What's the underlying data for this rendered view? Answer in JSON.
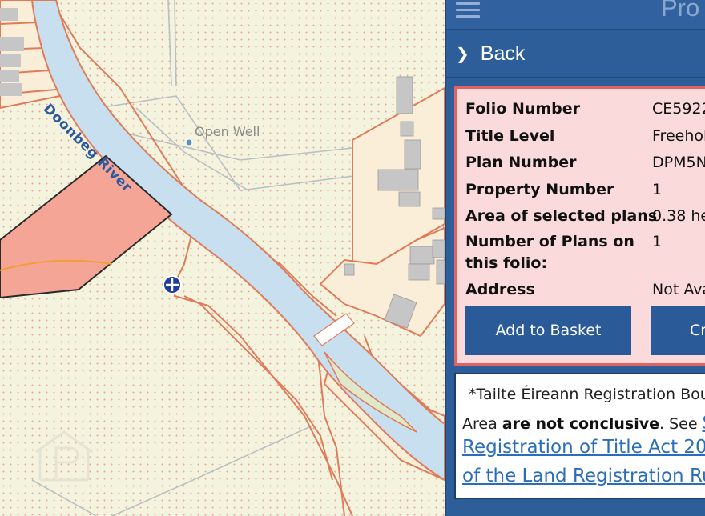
{
  "map": {
    "labels": {
      "river": "Doonbeg River",
      "well": "Open Well"
    },
    "colors": {
      "background": "#f4f4de",
      "river": "#c8dff0",
      "selected_plot": "#f4a596",
      "boundary": "#e07b5a",
      "buildings": "#bdbdbd"
    },
    "icons": {
      "marker": "crosshair-marker-icon",
      "watermark": "property-watermark-icon"
    }
  },
  "panel": {
    "menu_icon": "hamburger-icon",
    "title": "Pro",
    "back_label": "Back",
    "info": {
      "rows": [
        {
          "key": "Folio Number",
          "value": "CE5922"
        },
        {
          "key": "Title Level",
          "value": "Freehol"
        },
        {
          "key": "Plan Number",
          "value": "DPM5N"
        },
        {
          "key": "Property Number",
          "value": "1"
        },
        {
          "key": "Area of selected plans",
          "value": "0.38 he"
        },
        {
          "key": "Number of Plans on",
          "key2": "this folio:",
          "value": "1"
        },
        {
          "key": "Address",
          "value": "Not Ava"
        }
      ],
      "add_button": "Add to Basket",
      "create_button": "Cr"
    },
    "note": {
      "line1": "*Tailte Éireann Registration Bou",
      "line2_a": "Area ",
      "line2_bold": "are not conclusive",
      "line2_b": ". See ",
      "line2_link": "S",
      "link_line1": "Registration of Title Act 200",
      "link_line2": "of the Land Registration Ru"
    },
    "colors": {
      "panel_bg": "#2e5e99",
      "info_bg": "#fadadb",
      "info_border": "#e26262",
      "button_bg": "#2a5a97"
    }
  }
}
